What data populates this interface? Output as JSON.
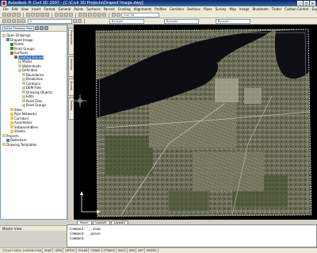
{
  "title": "Autodesk ® Civil 3D 2007 - [C:\\Civil 3D Projects\\Draped Image.dwg]",
  "menu": [
    "File",
    "Edit",
    "View",
    "Insert",
    "Format",
    "General",
    "Points",
    "Surfaces",
    "Parcels",
    "Grading",
    "Alignments",
    "Profiles",
    "Corridors",
    "Sections",
    "Pipes",
    "Survey",
    "Map",
    "Image",
    "Bluebeam",
    "Tinder",
    "Carbon Control",
    "Express",
    "Help"
  ],
  "toolbar": {
    "combo_civil": "Civil 3D",
    "combo_layer": "0",
    "combo_bylayer1": "ByLayer",
    "combo_bylayer2": "ByLayer",
    "combo_bylayer3": "ByLayer"
  },
  "prospector": {
    "view_combo": "Active Drawing View",
    "tabs": [
      "Prospector",
      "Settings",
      "Survey",
      "Toolbox"
    ],
    "tree": [
      {
        "label": "Open Drawings",
        "level": 0,
        "icon": "folder"
      },
      {
        "label": "Draped Image",
        "level": 1,
        "icon": "drawing"
      },
      {
        "label": "Points",
        "level": 2,
        "icon": "point"
      },
      {
        "label": "Point Groups",
        "level": 2,
        "icon": "point"
      },
      {
        "label": "Surfaces",
        "level": 2,
        "icon": "surface"
      },
      {
        "label": "Existing Ground",
        "level": 3,
        "icon": "surface",
        "selected": true
      },
      {
        "label": "Masks",
        "level": 4,
        "icon": "leaf"
      },
      {
        "label": "Watersheds",
        "level": 4,
        "icon": "leaf"
      },
      {
        "label": "Definition",
        "level": 4,
        "icon": "leaf"
      },
      {
        "label": "Boundaries",
        "level": 5,
        "icon": "leaf"
      },
      {
        "label": "Breaklines",
        "level": 5,
        "icon": "leaf"
      },
      {
        "label": "Contours",
        "level": 5,
        "icon": "leaf"
      },
      {
        "label": "DEM Files",
        "level": 5,
        "icon": "leaf"
      },
      {
        "label": "Drawing Objects",
        "level": 5,
        "icon": "leaf"
      },
      {
        "label": "Edits",
        "level": 5,
        "icon": "leaf"
      },
      {
        "label": "Point Files",
        "level": 5,
        "icon": "leaf"
      },
      {
        "label": "Point Groups",
        "level": 5,
        "icon": "leaf"
      },
      {
        "label": "Sites",
        "level": 2,
        "icon": "folder"
      },
      {
        "label": "Pipe Networks",
        "level": 2,
        "icon": "folder"
      },
      {
        "label": "Corridors",
        "level": 2,
        "icon": "folder"
      },
      {
        "label": "Assemblies",
        "level": 2,
        "icon": "folder"
      },
      {
        "label": "Subassemblies",
        "level": 2,
        "icon": "folder"
      },
      {
        "label": "Sheets",
        "level": 2,
        "icon": "folder"
      },
      {
        "label": "Projects",
        "level": 0,
        "icon": "folder"
      },
      {
        "label": "Datashare",
        "level": 1,
        "icon": "drawing"
      },
      {
        "label": "Drawing Templates",
        "level": 0,
        "icon": "folder"
      }
    ],
    "master_view": "Master View"
  },
  "side_tabs": [
    "Prospector",
    "Settings",
    "Survey",
    "Toolbox"
  ],
  "model_tabs": [
    "Model",
    "Layout1",
    "Layout2"
  ],
  "command_lines": [
    "Command: '_.zoom",
    "Command: _.qsave",
    "Command:"
  ],
  "status": {
    "coords": "171427.0010, 103406.2764, 0.0000",
    "toggles": [
      "SNAP",
      "GRID",
      "ORTHO",
      "POLAR",
      "OSNAP",
      "OTRACK",
      "DUCS",
      "DYN",
      "LWT",
      "MODEL"
    ]
  },
  "colors": {
    "accent": "#316ac5",
    "title_bar": "#0a246a",
    "viewport_bg": "#000000",
    "water": "#0b0d12",
    "land": "#6b6a52"
  }
}
